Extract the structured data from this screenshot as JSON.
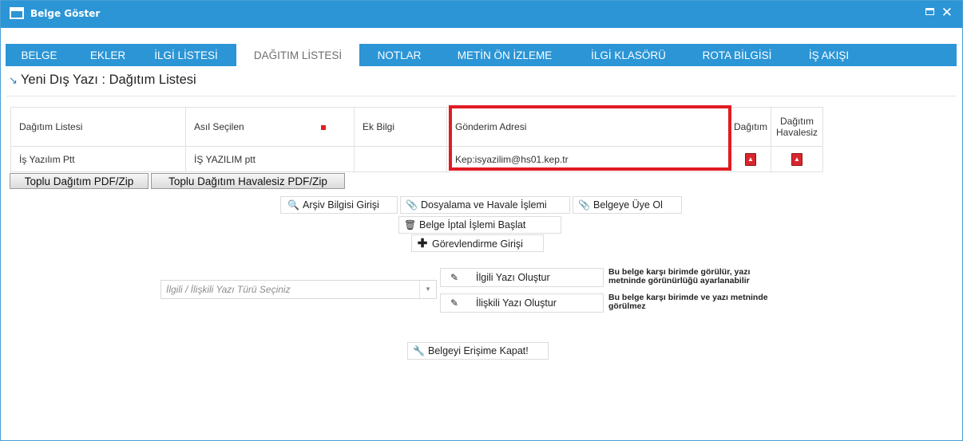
{
  "window": {
    "title": "Belge Göster"
  },
  "tabs": [
    {
      "label": "BELGE"
    },
    {
      "label": "EKLER"
    },
    {
      "label": "İLGİ LİSTESİ"
    },
    {
      "label": "DAĞITIM LİSTESİ",
      "active": true
    },
    {
      "label": "NOTLAR"
    },
    {
      "label": "METİN ÖN İZLEME"
    },
    {
      "label": "İLGİ KLASÖRÜ"
    },
    {
      "label": "ROTA BİLGİSİ"
    },
    {
      "label": "İŞ AKIŞI"
    }
  ],
  "page": {
    "title": "Yeni Dış Yazı : Dağıtım Listesi"
  },
  "table": {
    "headers": [
      "Dağıtım Listesi",
      "Asıl Seçilen",
      "Ek Bilgi",
      "Gönderim Adresi",
      "Dağıtım",
      "Dağıtım Havalesiz"
    ],
    "rows": [
      {
        "dagitim_listesi": "İş Yazılım Ptt",
        "asil_secilen": "İŞ YAZILIM ptt",
        "ek_bilgi": "",
        "gonderim_adresi": "Kep:isyazilim@hs01.kep.tr"
      }
    ]
  },
  "buttons": {
    "toplu_pdf": "Toplu Dağıtım PDF/Zip",
    "toplu_havalesiz": "Toplu Dağıtım Havalesiz PDF/Zip",
    "arsiv": "Arşiv Bilgisi Girişi",
    "dosyalama": "Dosyalama ve Havale İşlemi",
    "uye_ol": "Belgeye Üye Ol",
    "iptal": "Belge İptal İşlemi Başlat",
    "gorevlendirme": "Görevlendirme Girişi",
    "ilgili_yazi": "İlgili Yazı Oluştur",
    "iliskili_yazi": "İlişkili Yazı Oluştur",
    "erisime_kapat": "Belgeyi Erişime Kapat!"
  },
  "select": {
    "placeholder": "İlgili / İlişkili Yazı Türü Seçiniz"
  },
  "notes": {
    "ilgili": "Bu belge karşı birimde görülür, yazı metninde görünürlüğü ayarlanabilir",
    "iliskili": "Bu belge karşı birimde ve yazı metninde görülmez"
  },
  "colors": {
    "accent": "#2b95d6",
    "highlight": "#e11b22"
  },
  "icons": [
    "window-icon",
    "maximize-icon",
    "close-icon",
    "arrow-icon",
    "search-icon",
    "paperclip-icon",
    "trash-icon",
    "plus-icon",
    "pencil-icon",
    "wrench-icon",
    "pdf-icon"
  ]
}
